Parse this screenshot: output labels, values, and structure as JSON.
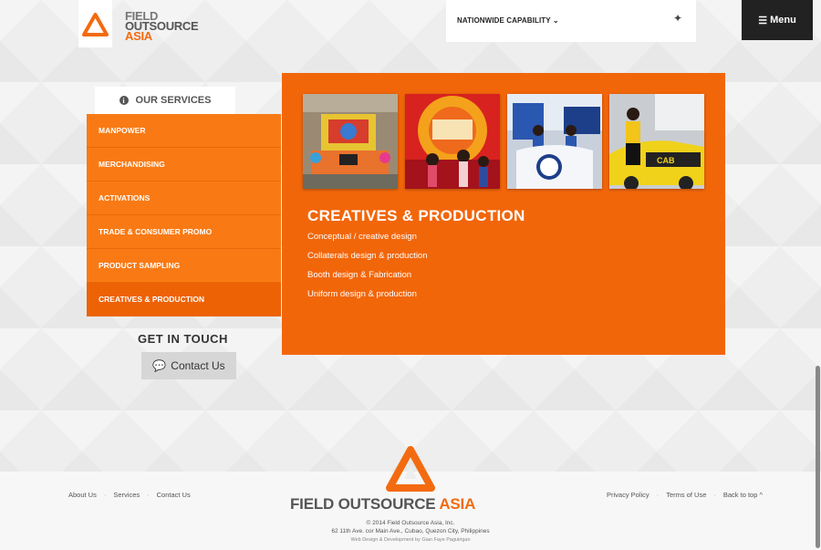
{
  "brand": {
    "line1": "FIELD",
    "line2": "OUTSOURCE",
    "line3": "ASIA",
    "footer_a": "FIELD OUTSOURCE ",
    "footer_b": "ASIA",
    "color": "#f36b10"
  },
  "header": {
    "nationwide_label": "NATIONWIDE CAPABILITY",
    "menu_label": "Menu"
  },
  "sidebar": {
    "heading": "OUR SERVICES",
    "items": [
      {
        "label": "MANPOWER"
      },
      {
        "label": "MERCHANDISING"
      },
      {
        "label": "ACTIVATIONS"
      },
      {
        "label": "TRADE & CONSUMER PROMO"
      },
      {
        "label": "PRODUCT SAMPLING"
      },
      {
        "label": "CREATIVES & PRODUCTION"
      }
    ],
    "active_item": "CREATIVES & PRODUCTION"
  },
  "get_in_touch": {
    "title": "GET IN TOUCH",
    "button": "Contact Us"
  },
  "panel": {
    "title": "CREATIVES & PRODUCTION",
    "items": [
      "Conceptual / creative design",
      "Collaterals design & production",
      "Booth design & Fabrication",
      "Uniform design & production"
    ],
    "background": "#f2660a"
  },
  "footer": {
    "left_links": [
      "About Us",
      "Services",
      "Contact Us"
    ],
    "right_links": [
      "Privacy Policy",
      "Terms of Use",
      "Back to top ^"
    ],
    "copyright": "© 2014 Field Outsource Asia, Inc.",
    "address": "62 11th Ave. cor Main Ave., Cubao, Quezon City, Philippines",
    "credit": "Web Design & Development by Gian Faye Paguirigan"
  }
}
